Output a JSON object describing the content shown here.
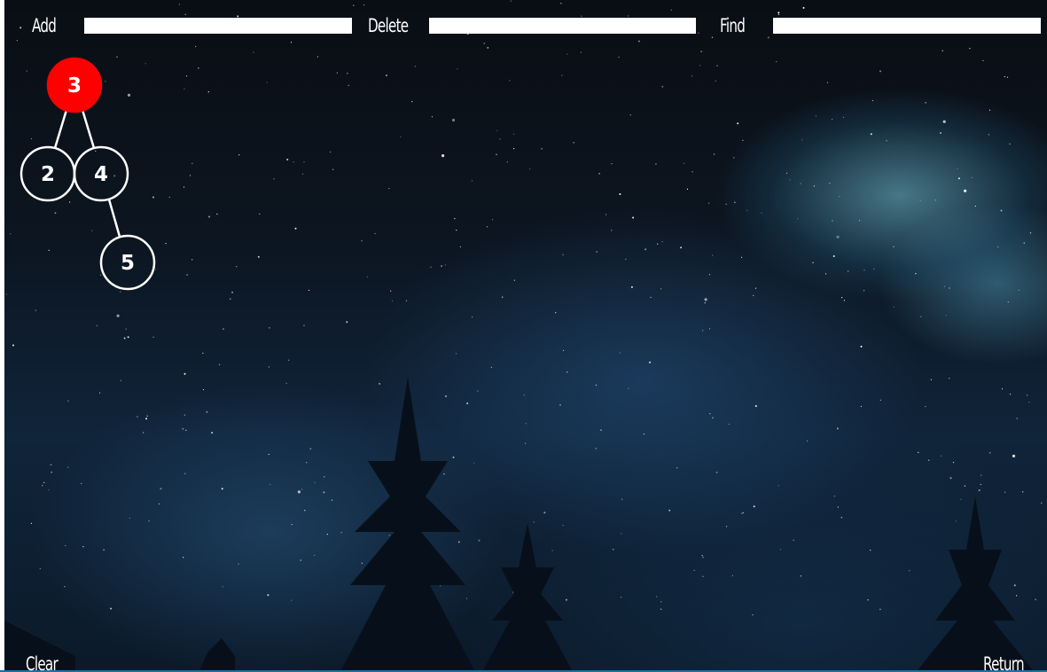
{
  "toolbar": {
    "add_label": "Add",
    "delete_label": "Delete",
    "find_label": "Find",
    "add_value": "",
    "delete_value": "",
    "find_value": ""
  },
  "bst": {
    "nodes": [
      {
        "key": "3",
        "highlighted": true
      },
      {
        "key": "2",
        "highlighted": false
      },
      {
        "key": "4",
        "highlighted": false
      },
      {
        "key": "5",
        "highlighted": false
      }
    ],
    "highlight_color": "#ff0000"
  },
  "footer": {
    "clear_label": "Clear",
    "return_label": "Return"
  }
}
